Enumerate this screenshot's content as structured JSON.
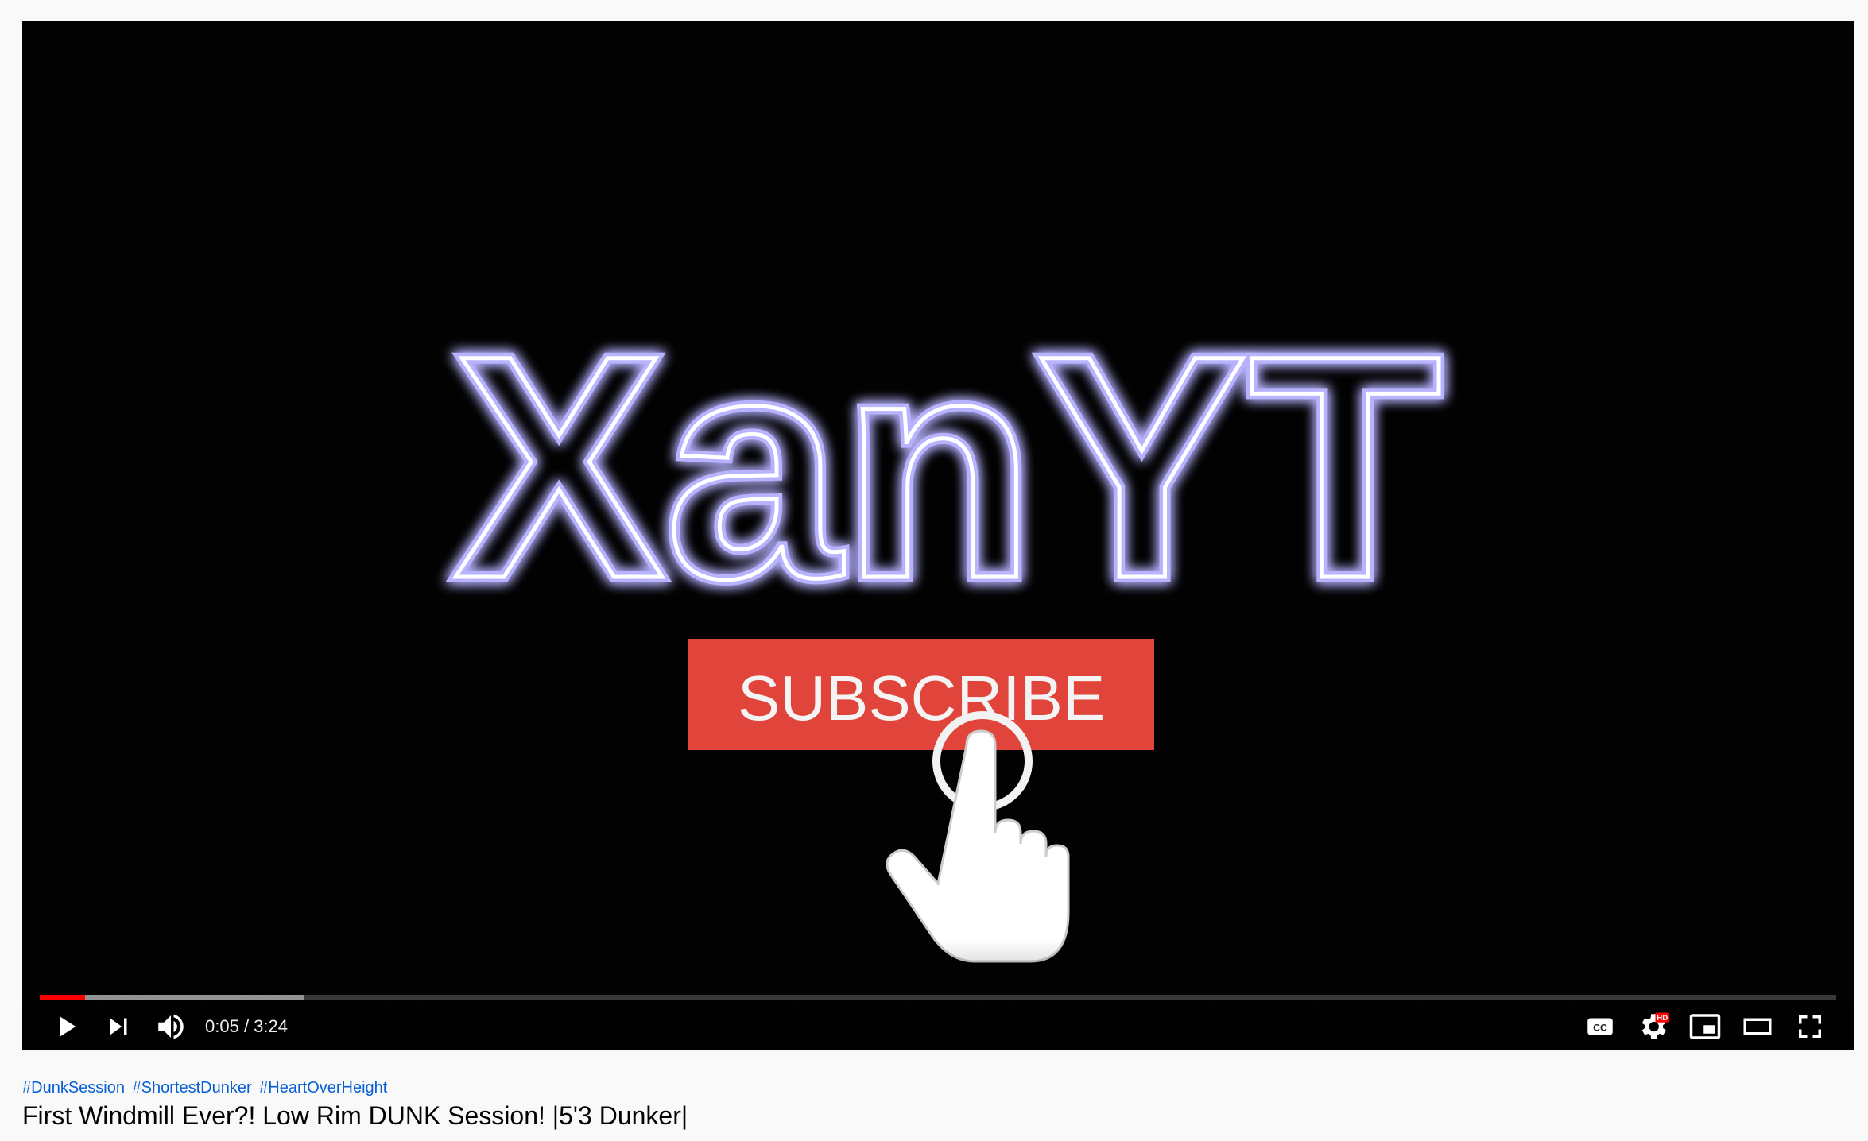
{
  "video": {
    "logo_text": "XanYT",
    "subscribe_label": "SUBSCRIBE",
    "cursor_icon": "hand-pointer-icon"
  },
  "player": {
    "current_time": "0:05",
    "time_separator": " / ",
    "duration": "3:24",
    "played_fraction": 0.025,
    "buffered_fraction": 0.147,
    "colors": {
      "progress": "#ff0000",
      "subscribe": "#e0443a"
    },
    "controls": {
      "play_icon": "play-icon",
      "next_icon": "next-icon",
      "volume_icon": "volume-icon",
      "captions_icon": "captions-icon",
      "settings_icon": "settings-hd-icon",
      "settings_badge": "HD",
      "miniplayer_icon": "miniplayer-icon",
      "theater_icon": "theater-icon",
      "fullscreen_icon": "fullscreen-icon"
    }
  },
  "meta": {
    "hashtags": [
      "#DunkSession",
      "#ShortestDunker",
      "#HeartOverHeight"
    ],
    "title": "First Windmill Ever?! Low Rim DUNK Session! |5'3 Dunker|"
  }
}
